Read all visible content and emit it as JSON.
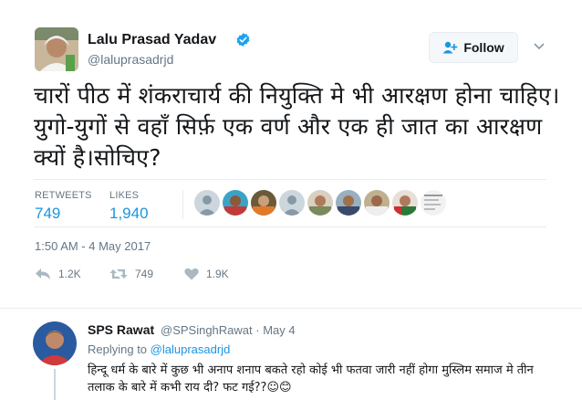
{
  "tweet": {
    "author_name": "Lalu Prasad Yadav",
    "author_handle": "@laluprasadrjd",
    "follow_label": "Follow",
    "text": "चारों पीठ में शंकराचार्य की नियुक्ति मे भी आरक्षण होना चाहिए।युगो-युगों से वहाँ सिर्फ़ एक वर्ण और एक ही जात का आरक्षण क्यों है।सोचिए?",
    "retweets_label": "RETWEETS",
    "retweets_count": "749",
    "likes_label": "LIKES",
    "likes_count": "1,940",
    "timestamp": "1:50 AM - 4 May 2017",
    "actions": {
      "reply_count": "1.2K",
      "retweet_count": "749",
      "like_count": "1.9K"
    }
  },
  "reply": {
    "author_name": "SPS Rawat",
    "author_handle": "@SPSinghRawat",
    "date": "· May 4",
    "replying_prefix": "Replying to",
    "replying_to": "@laluprasadrjd",
    "text": "हिन्दू धर्म के बारे में कुछ भी अनाप शनाप बकते रहो कोई भी फतवा जारी नहीं होगा मुस्लिम समाज मे तीन तलाक के बारे में कभी राय दी? फट गई??☺😊"
  },
  "colors": {
    "accent": "#1b95e0",
    "muted": "#657786",
    "verified": "#1da1f2"
  }
}
